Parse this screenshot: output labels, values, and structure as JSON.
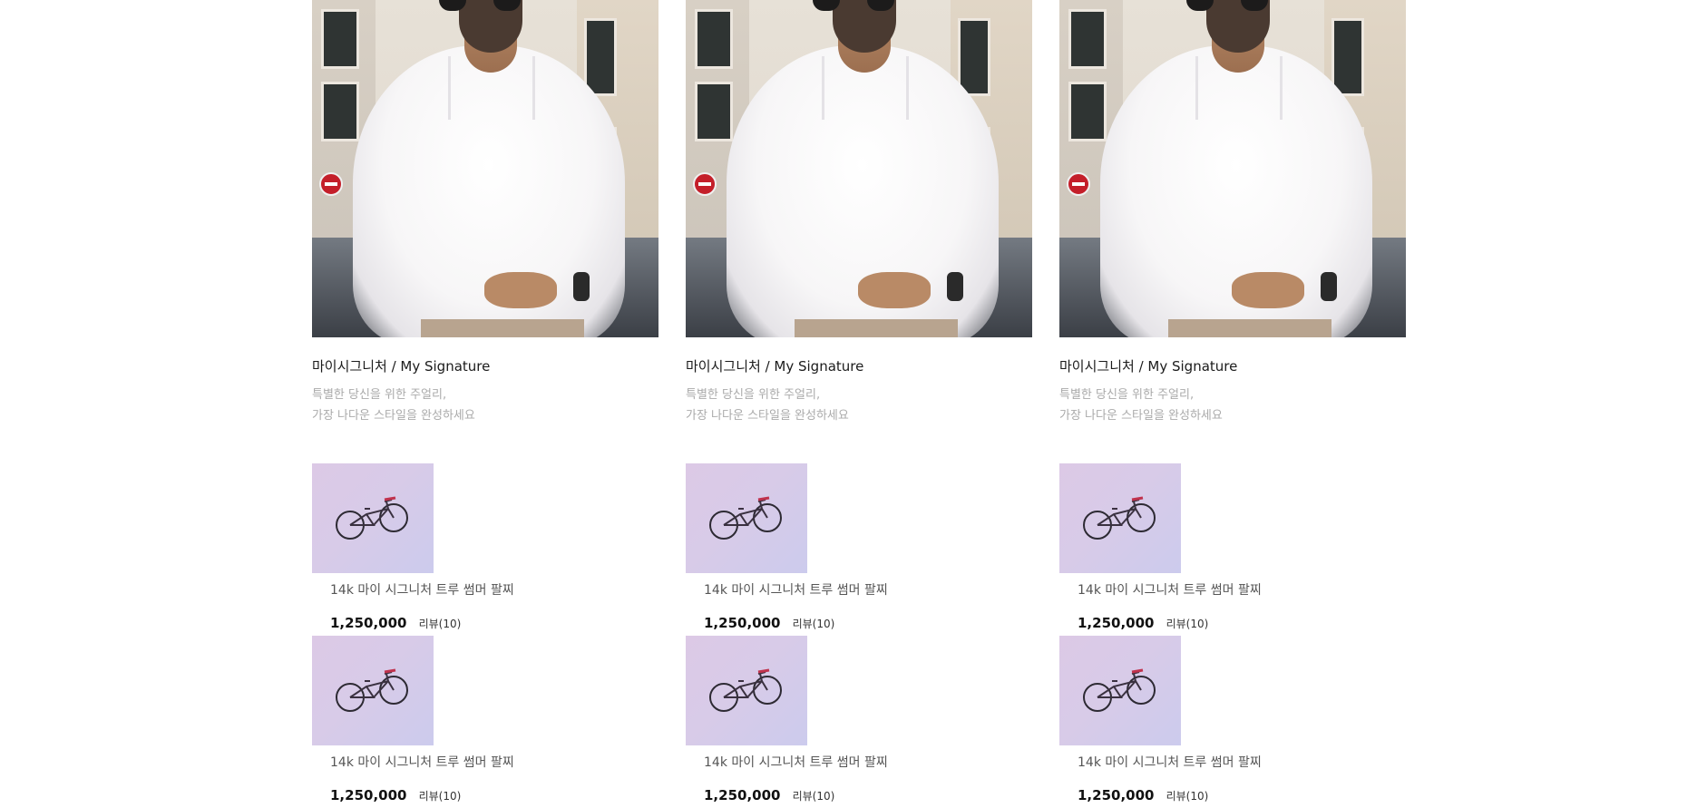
{
  "collections": [
    {
      "title": "마이시그니처 / My Signature",
      "description_line1": "특별한 당신을 위한 주얼리,",
      "description_line2": "가장 나다운 스타일을 완성하세요",
      "products": [
        {
          "name": "14k 마이 시그니처 트루 썸머 팔찌",
          "price": "1,250,000",
          "reviews": "리뷰(10)"
        },
        {
          "name": "14k 마이 시그니처 트루 썸머 팔찌",
          "price": "1,250,000",
          "reviews": "리뷰(10)"
        }
      ]
    },
    {
      "title": "마이시그니처 / My Signature",
      "description_line1": "특별한 당신을 위한 주얼리,",
      "description_line2": "가장 나다운 스타일을 완성하세요",
      "products": [
        {
          "name": "14k 마이 시그니처 트루 썸머 팔찌",
          "price": "1,250,000",
          "reviews": "리뷰(10)"
        },
        {
          "name": "14k 마이 시그니처 트루 썸머 팔찌",
          "price": "1,250,000",
          "reviews": "리뷰(10)"
        }
      ]
    },
    {
      "title": "마이시그니처 / My Signature",
      "description_line1": "특별한 당신을 위한 주얼리,",
      "description_line2": "가장 나다운 스타일을 완성하세요",
      "products": [
        {
          "name": "14k 마이 시그니처 트루 썸머 팔찌",
          "price": "1,250,000",
          "reviews": "리뷰(10)"
        },
        {
          "name": "14k 마이 시그니처 트루 썸머 팔찌",
          "price": "1,250,000",
          "reviews": "리뷰(10)"
        }
      ]
    }
  ]
}
